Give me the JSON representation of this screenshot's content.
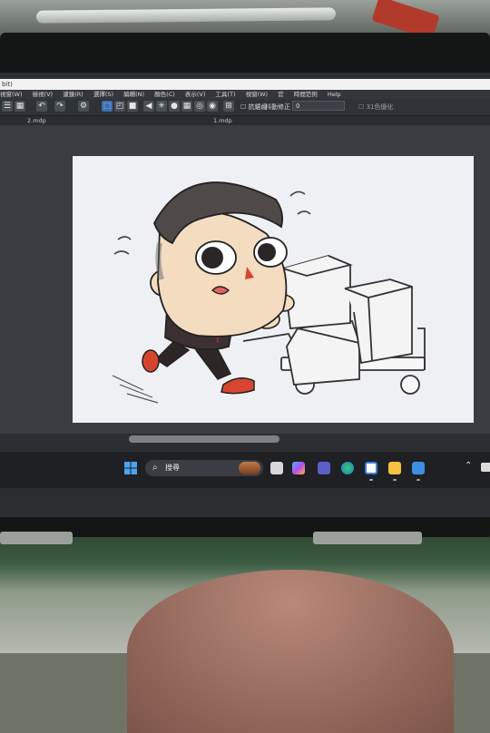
{
  "app": {
    "title_fragment": "bit)",
    "menu": [
      "視窗(W)",
      "檢視(V)",
      "濾鏡(R)",
      "選擇(S)",
      "編輯(N)",
      "顏色(C)",
      "表示(V)",
      "工具(T)",
      "視窗(W)",
      "官",
      "時間范例",
      "Help"
    ],
    "toolbar": {
      "fill_label": "☐ 抗鋸齒",
      "zoom_label": "抖動修正",
      "zoom_value": "0",
      "dither_label": "☐ 31色優化"
    },
    "tabs": [
      "2.mdp",
      "1.mdp"
    ]
  },
  "canvas": {
    "artwork": "chibi-character-pushing-hand-truck-with-boxes"
  },
  "taskbar": {
    "search_placeholder": "搜尋",
    "apps": [
      "task-view",
      "copilot",
      "teams",
      "edge",
      "chrome",
      "file-explorer",
      "paint-app"
    ]
  },
  "colors": {
    "accent": "#3d6fb3",
    "shoe": "#d8452e",
    "skin": "#f3dcc0",
    "jacket": "#3b3032"
  }
}
